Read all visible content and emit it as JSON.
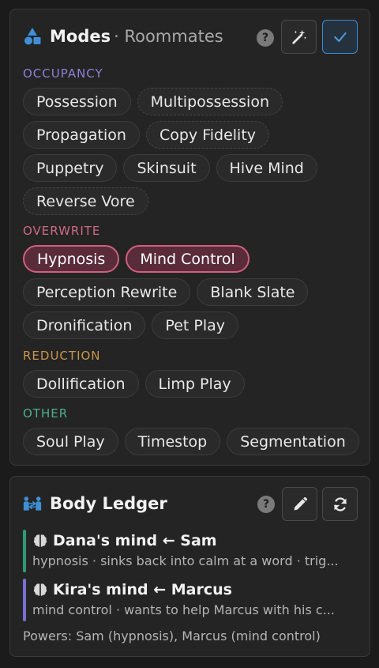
{
  "modes": {
    "title": "Modes",
    "subtitle": "· Roommates",
    "help": "?",
    "sections": {
      "occupancy": {
        "label": "OCCUPANCY",
        "color": "#8f7fd8",
        "chips": [
          "Possession",
          "Multipossession",
          "Propagation",
          "Copy Fidelity",
          "Puppetry",
          "Skinsuit",
          "Hive Mind",
          "Reverse Vore"
        ]
      },
      "overwrite": {
        "label": "OVERWRITE",
        "color": "#cf6a86",
        "chips": [
          "Hypnosis",
          "Mind Control",
          "Perception Rewrite",
          "Blank Slate",
          "Dronification",
          "Pet Play"
        ]
      },
      "reduction": {
        "label": "REDUCTION",
        "color": "#c9954a",
        "chips": [
          "Dollification",
          "Limp Play"
        ]
      },
      "other": {
        "label": "OTHER",
        "color": "#4fae8e",
        "chips": [
          "Soul Play",
          "Timestop",
          "Segmentation"
        ]
      }
    },
    "selected": [
      "Hypnosis",
      "Mind Control"
    ]
  },
  "ledger": {
    "title": "Body Ledger",
    "help": "?",
    "entries": [
      {
        "title": "Dana's mind ← Sam",
        "desc": "hypnosis · sinks back into calm at a word · trig...",
        "color": "#2f9a76"
      },
      {
        "title": "Kira's mind ← Marcus",
        "desc": "mind control · wants to help Marcus with his c...",
        "color": "#7b6fd0"
      }
    ],
    "powers": "Powers: Sam (hypnosis), Marcus (mind control)"
  },
  "colors": {
    "accent": "#3a8ed6",
    "selected_chip": "#d0607d",
    "panel": "#242424"
  },
  "icons": {
    "modes": "shapes-icon",
    "magic": "magic-wand-icon",
    "confirm": "check-icon",
    "ledger": "people-arrows-icon",
    "edit": "pencil-icon",
    "refresh": "refresh-icon",
    "brain": "brain-icon"
  }
}
